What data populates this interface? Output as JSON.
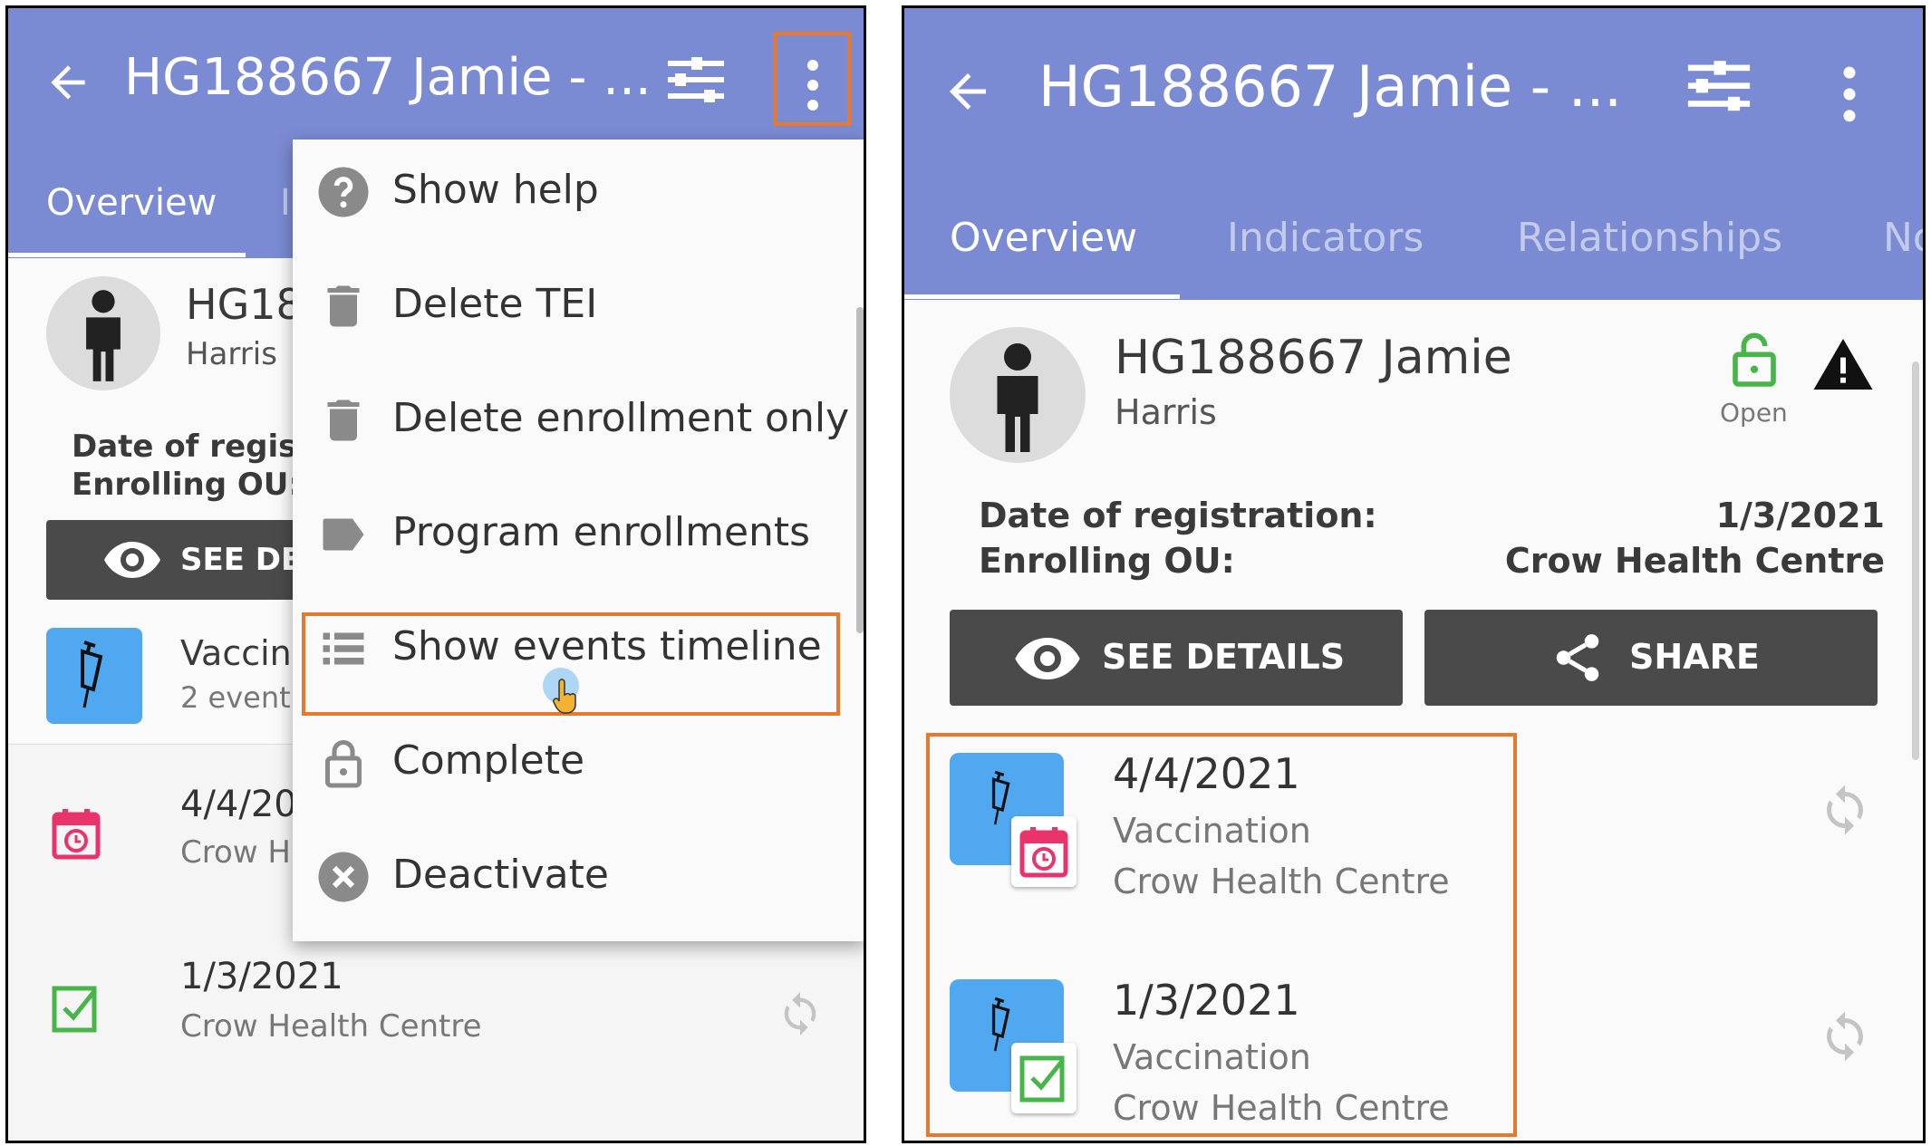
{
  "left": {
    "appbar": {
      "title": "HG188667 Jamie - ...",
      "tabs": [
        "Overview",
        "I"
      ]
    },
    "profile": {
      "name": "HG18",
      "surname": "Harris"
    },
    "labels": {
      "date_of_registration": "Date of registr",
      "enrolling_ou": "Enrolling OU:"
    },
    "see_details": "SEE DE",
    "stage": {
      "name": "Vaccin",
      "count": "2 event"
    },
    "events": [
      {
        "date": "4/4/20",
        "org": "Crow H"
      },
      {
        "date": "1/3/2021",
        "org": "Crow Health Centre"
      }
    ],
    "menu": {
      "items": [
        {
          "label": "Show help",
          "icon": "help-icon"
        },
        {
          "label": "Delete TEI",
          "icon": "trash-icon"
        },
        {
          "label": "Delete enrollment only",
          "icon": "trash-icon"
        },
        {
          "label": "Program enrollments",
          "icon": "label-tag-icon"
        },
        {
          "label": "Show events timeline",
          "icon": "list-icon"
        },
        {
          "label": "Complete",
          "icon": "lock-icon"
        },
        {
          "label": "Deactivate",
          "icon": "cancel-circle-icon"
        }
      ]
    }
  },
  "right": {
    "appbar": {
      "title": "HG188667 Jamie - ...",
      "tabs": [
        "Overview",
        "Indicators",
        "Relationships",
        "No"
      ]
    },
    "profile": {
      "name": "HG188667 Jamie",
      "surname": "Harris",
      "status": "Open"
    },
    "labels": {
      "date_of_registration": "Date of registration:",
      "date_value": "1/3/2021",
      "enrolling_ou": "Enrolling OU:",
      "enrolling_ou_value": "Crow Health Centre"
    },
    "buttons": {
      "see_details": "SEE DETAILS",
      "share": "SHARE"
    },
    "events": [
      {
        "date": "4/4/2021",
        "stage": "Vaccination",
        "org": "Crow Health Centre"
      },
      {
        "date": "1/3/2021",
        "stage": "Vaccination",
        "org": "Crow Health Centre"
      }
    ]
  },
  "colors": {
    "appbar": "#7b8bd3",
    "highlight": "#e8782e",
    "stage_blue": "#4fa8f0",
    "overdue": "#e8336b",
    "completed": "#47b54a"
  }
}
